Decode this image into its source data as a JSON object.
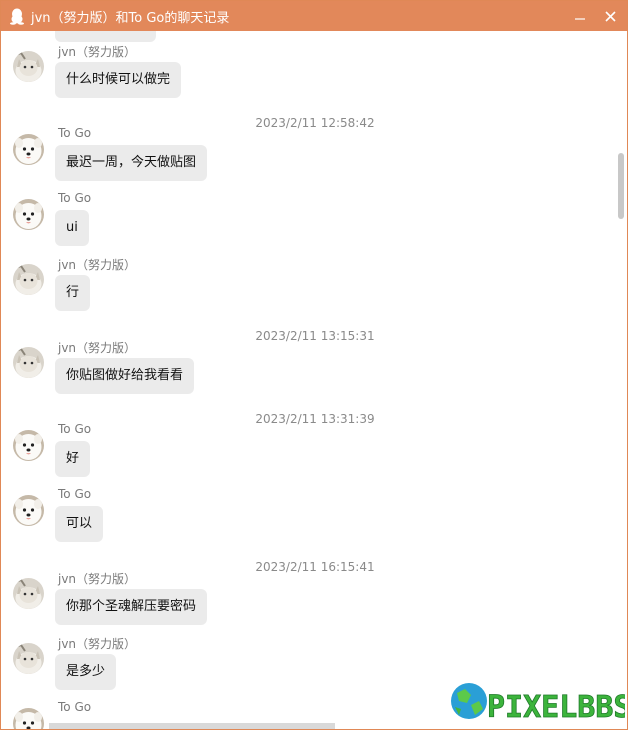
{
  "window": {
    "title": "jvn（努力版）和To Go的聊天记录",
    "minimize_label": "—",
    "close_label": "✕",
    "accent_color": "#e2885a"
  },
  "messages": [
    {
      "sender": "jvn（努力版）",
      "text": "什么时候可以做完",
      "avatar": "cat-avatar"
    },
    {
      "timestamp": "2023/2/11 12:58:42"
    },
    {
      "sender": "To Go",
      "text": "最迟一周，今天做贴图",
      "avatar": "dog-avatar"
    },
    {
      "sender": "To Go",
      "text": "ui",
      "avatar": "dog-avatar"
    },
    {
      "sender": "jvn（努力版）",
      "text": "行",
      "avatar": "cat-avatar"
    },
    {
      "timestamp": "2023/2/11 13:15:31"
    },
    {
      "sender": "jvn（努力版）",
      "text": "你贴图做好给我看看",
      "avatar": "cat-avatar"
    },
    {
      "timestamp": "2023/2/11 13:31:39"
    },
    {
      "sender": "To Go",
      "text": "好",
      "avatar": "dog-avatar"
    },
    {
      "sender": "To Go",
      "text": "可以",
      "avatar": "dog-avatar"
    },
    {
      "timestamp": "2023/2/11 16:15:41"
    },
    {
      "sender": "jvn（努力版）",
      "text": "你那个圣魂解压要密码",
      "avatar": "cat-avatar"
    },
    {
      "sender": "jvn（努力版）",
      "text": "是多少",
      "avatar": "cat-avatar"
    },
    {
      "sender": "To Go",
      "text": "",
      "avatar": "dog-avatar"
    }
  ],
  "watermark": {
    "text": "PIXELBBS"
  }
}
